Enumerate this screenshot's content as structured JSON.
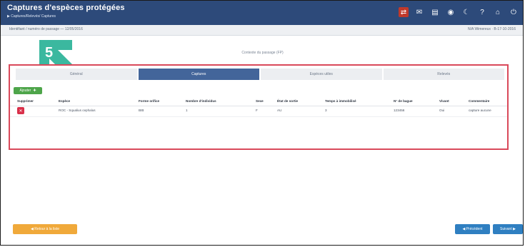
{
  "app": {
    "title": "Captures d'espèces protégées",
    "subtitle": "▶ Captures/Relevés/ Captures"
  },
  "info_bar": {
    "left": "Identifiant / numéro de passage — 12/05/2016",
    "right": "N/A  Wimereux · B-17-10-2016"
  },
  "top_icons": [
    "usb-icon",
    "chat-icon",
    "trash-icon",
    "wifi-icon",
    "moon-icon",
    "help-icon",
    "home-icon",
    "exit-icon"
  ],
  "step_number": "5",
  "caption": "Contexte du passage (FP)",
  "tabs": [
    {
      "label": "Général",
      "active": false
    },
    {
      "label": "Captures",
      "active": true
    },
    {
      "label": "Espèces utiles",
      "active": false
    },
    {
      "label": "Relevés",
      "active": false
    }
  ],
  "add_button": {
    "label": "Ajouter"
  },
  "table": {
    "columns": [
      "Supprimer",
      "Espèce",
      "Forme orifice",
      "Nombre d'individus",
      "Sexe",
      "État de sortie",
      "Temps à immobilisé",
      "N° de bague",
      "Vivant",
      "Commentaire"
    ],
    "rows": [
      [
        "",
        "ROC - Squalius cephalus",
        "BIB",
        "1",
        "F",
        "AU",
        "3",
        "123456",
        "Oui",
        "capture aucune"
      ]
    ]
  },
  "footer": {
    "return_label": "◀ Retour à la liste",
    "prev_label": "◀ Précédent",
    "next_label": "Suivant ▶"
  },
  "colors": {
    "topbar": "#2d4a7a",
    "active_tab": "#43659a",
    "highlight_border": "#d9495a",
    "badge": "#3bb89f",
    "add_button": "#4ea54a",
    "delete_button": "#d9304a",
    "return_button": "#f0a93a",
    "nav_button": "#2f7fc1"
  }
}
